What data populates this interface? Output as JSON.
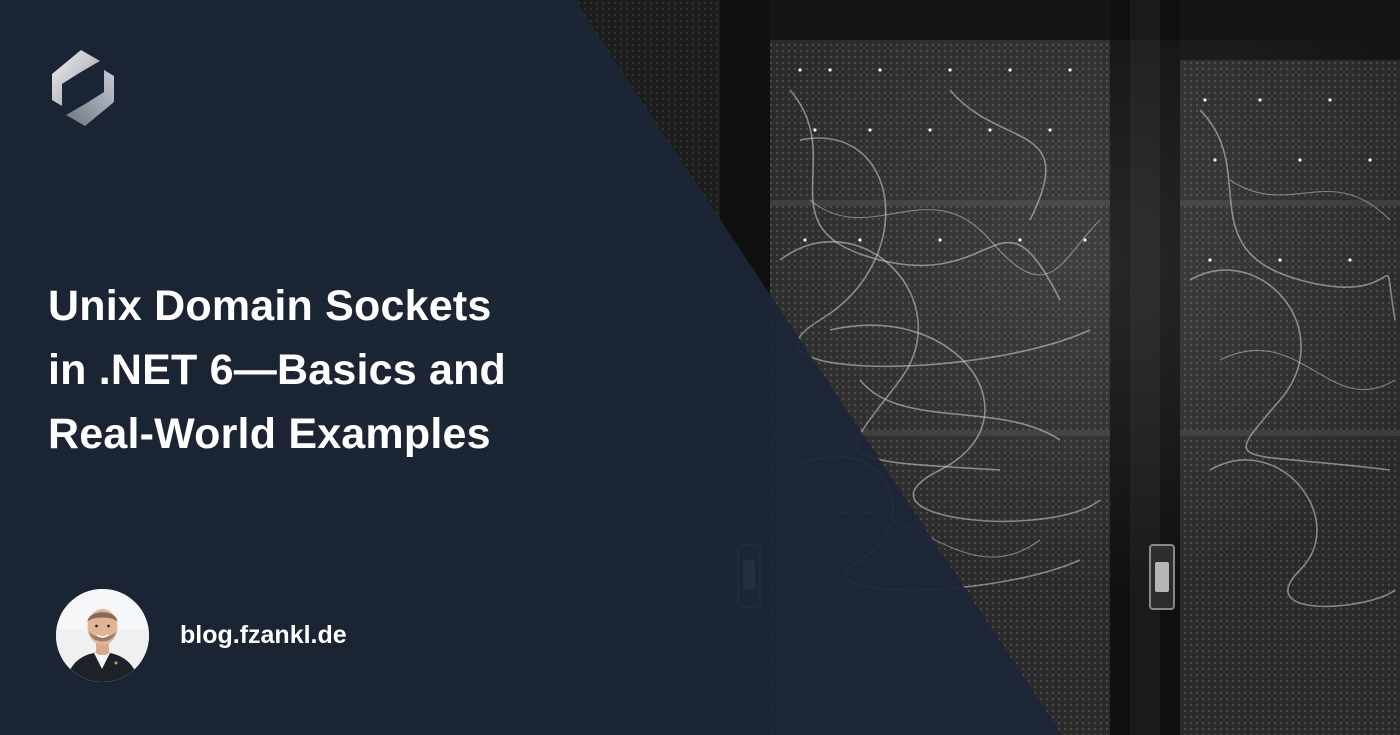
{
  "card": {
    "title_lines": [
      "Unix Domain Sockets",
      "in .NET 6—Basics and",
      "Real-World Examples"
    ],
    "site_url": "blog.fzankl.de"
  },
  "icons": {
    "logo": "hexagon-chain-logo-icon",
    "avatar": "author-portrait"
  },
  "colors": {
    "overlay_navy": "#1b2636",
    "title_text": "#ffffff",
    "url_text": "#ffffff",
    "photo_base": "#141414"
  }
}
